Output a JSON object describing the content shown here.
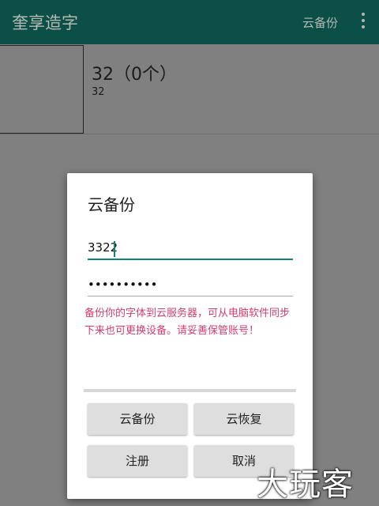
{
  "app": {
    "title": "奎享造字",
    "action_label": "云备份"
  },
  "list": {
    "title": "32（0个）",
    "subtitle": "32"
  },
  "dialog": {
    "title": "云备份",
    "username_value": "3322",
    "password_value": "••••••••••",
    "notice": "备份你的字体到云服务器，可从电脑软件同步下来也可更换设备。请妥善保管账号！",
    "buttons": {
      "backup": "云备份",
      "restore": "云恢复",
      "register": "注册",
      "cancel": "取消"
    }
  },
  "watermark": "大玩客",
  "colors": {
    "appbar": "#0b4f46",
    "accent": "#128476",
    "notice": "#d43d6d"
  }
}
